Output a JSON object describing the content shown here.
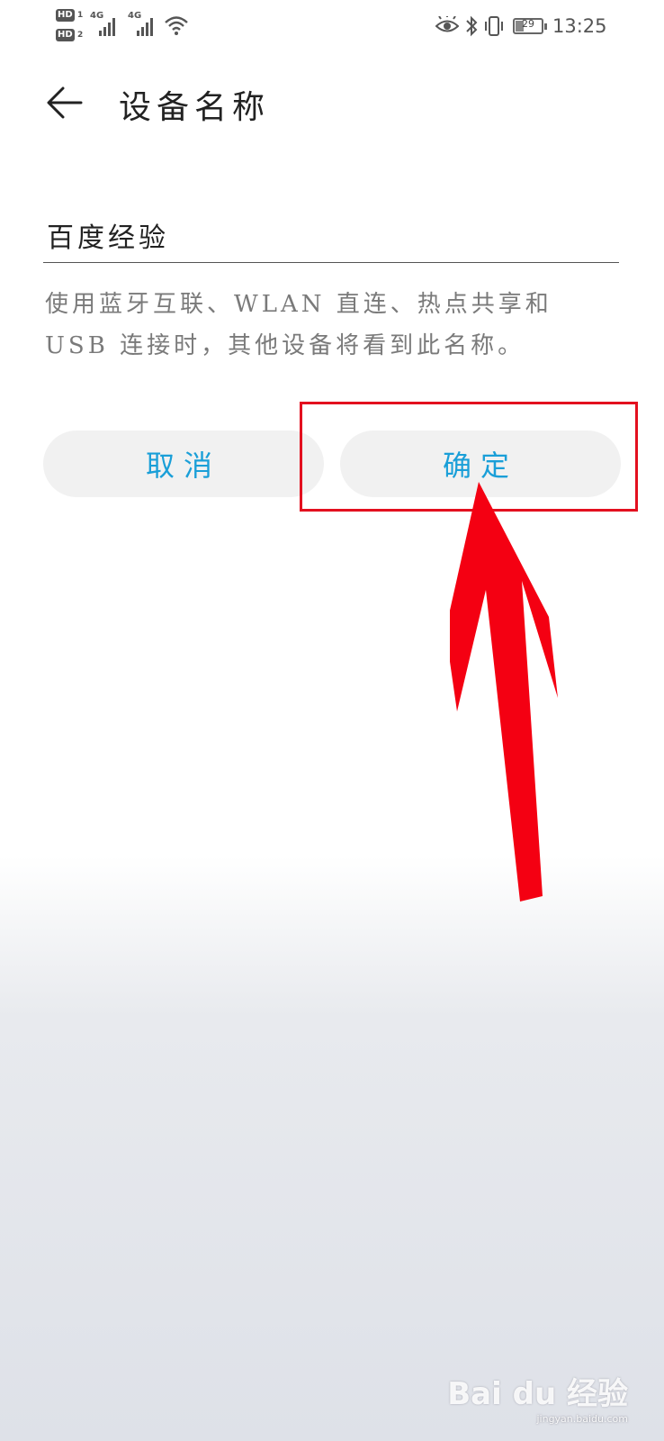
{
  "status_bar": {
    "sim1": "HD",
    "sim1_index": "1",
    "sim2": "HD",
    "sim2_index": "2",
    "network1": "4G",
    "network2": "4G",
    "battery_level": "29",
    "battery_fraction": 0.29,
    "time": "13:25"
  },
  "header": {
    "title": "设备名称"
  },
  "name_input": {
    "value": "百度经验"
  },
  "hint": {
    "text": "使用蓝牙互联、WLAN 直连、热点共享和 USB 连接时，其他设备将看到此名称。"
  },
  "buttons": {
    "cancel": "取消",
    "confirm": "确定"
  },
  "colors": {
    "accent": "#1a9fd8",
    "button_bg": "#f1f1f1",
    "annotation": "#e3101f"
  },
  "watermark": {
    "logo": "Bai du 经验",
    "url": "jingyan.baidu.com"
  }
}
